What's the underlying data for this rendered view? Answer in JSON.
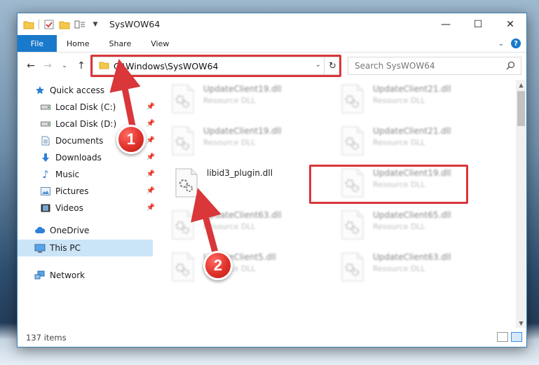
{
  "window": {
    "title": "SysWOW64",
    "controls": {
      "minimize": "—",
      "maximize": "☐",
      "close": "✕"
    }
  },
  "ribbon": {
    "tabs": [
      "File",
      "Home",
      "Share",
      "View"
    ]
  },
  "address": {
    "path": "C:\\Windows\\SysWOW64",
    "search_placeholder": "Search SysWOW64"
  },
  "sidebar": {
    "quick_access": "Quick access",
    "pinned": [
      "Local Disk (C:)",
      "Local Disk (D:)",
      "Documents",
      "Downloads",
      "Music",
      "Pictures",
      "Videos"
    ],
    "onedrive": "OneDrive",
    "this_pc": "This PC",
    "network": "Network"
  },
  "files": [
    {
      "name": "UpdateClient19.dll",
      "type": "Resource DLL"
    },
    {
      "name": "UpdateClient21.dll",
      "type": "Resource DLL"
    },
    {
      "name": "UpdateClient19.dll",
      "type": "Resource DLL"
    },
    {
      "name": "UpdateClient21.dll",
      "type": "Resource DLL"
    },
    {
      "name": "libid3_plugin.dll",
      "type": ""
    },
    {
      "name": "UpdateClient19.dll",
      "type": "Resource DLL"
    },
    {
      "name": "UpdateClient63.dll",
      "type": "Resource DLL"
    },
    {
      "name": "UpdateClient65.dll",
      "type": "Resource DLL"
    },
    {
      "name": "UpdateClient5.dll",
      "type": "Resource DLL"
    },
    {
      "name": "UpdateClient63.dll",
      "type": "Resource DLL"
    }
  ],
  "status": {
    "item_count": "137 items"
  },
  "annotations": {
    "step1": "1",
    "step2": "2",
    "color": "#d9373a"
  }
}
